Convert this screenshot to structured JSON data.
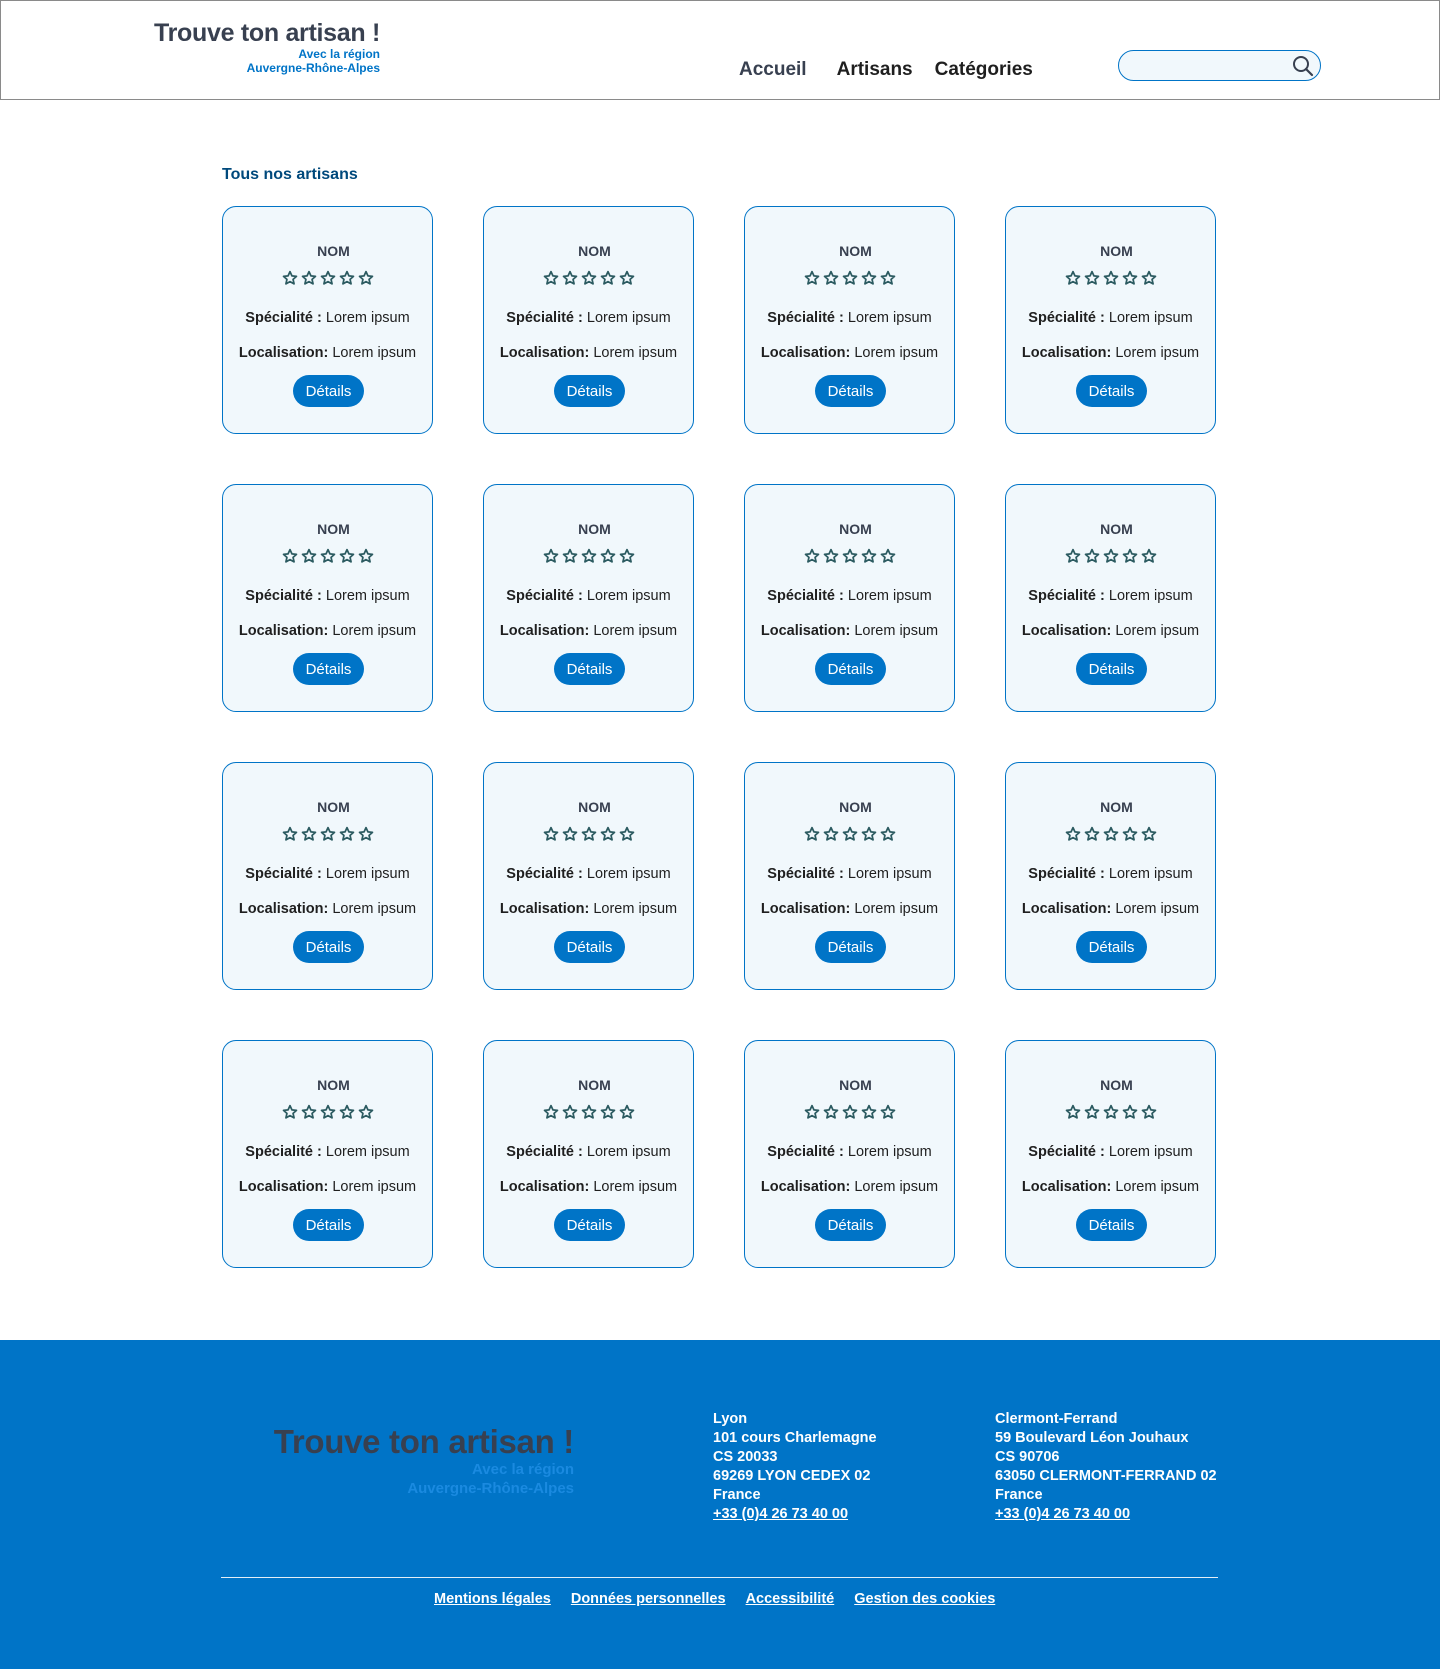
{
  "brand": {
    "title": "Trouve ton artisan !",
    "subtitle_1": "Avec la région",
    "subtitle_2": "Auvergne-Rhône-Alpes"
  },
  "nav": {
    "items": [
      {
        "label": "Accueil"
      },
      {
        "label": "Artisans"
      },
      {
        "label": "Catégories"
      }
    ]
  },
  "search": {
    "value": "",
    "icon": "search-icon"
  },
  "main": {
    "section_title": "Tous nos artisans",
    "cards": [
      {
        "name": "NOM",
        "rating": 0,
        "specialty_label": "Spécialité :",
        "specialty": "Lorem ipsum",
        "location_label": "Localisation:",
        "location": "Lorem ipsum",
        "button": "Détails"
      },
      {
        "name": "NOM",
        "rating": 0,
        "specialty_label": "Spécialité :",
        "specialty": "Lorem ipsum",
        "location_label": "Localisation:",
        "location": "Lorem ipsum",
        "button": "Détails"
      },
      {
        "name": "NOM",
        "rating": 0,
        "specialty_label": "Spécialité :",
        "specialty": "Lorem ipsum",
        "location_label": "Localisation:",
        "location": "Lorem ipsum",
        "button": "Détails"
      },
      {
        "name": "NOM",
        "rating": 0,
        "specialty_label": "Spécialité :",
        "specialty": "Lorem ipsum",
        "location_label": "Localisation:",
        "location": "Lorem ipsum",
        "button": "Détails"
      },
      {
        "name": "NOM",
        "rating": 0,
        "specialty_label": "Spécialité :",
        "specialty": "Lorem ipsum",
        "location_label": "Localisation:",
        "location": "Lorem ipsum",
        "button": "Détails"
      },
      {
        "name": "NOM",
        "rating": 0,
        "specialty_label": "Spécialité :",
        "specialty": "Lorem ipsum",
        "location_label": "Localisation:",
        "location": "Lorem ipsum",
        "button": "Détails"
      },
      {
        "name": "NOM",
        "rating": 0,
        "specialty_label": "Spécialité :",
        "specialty": "Lorem ipsum",
        "location_label": "Localisation:",
        "location": "Lorem ipsum",
        "button": "Détails"
      },
      {
        "name": "NOM",
        "rating": 0,
        "specialty_label": "Spécialité :",
        "specialty": "Lorem ipsum",
        "location_label": "Localisation:",
        "location": "Lorem ipsum",
        "button": "Détails"
      },
      {
        "name": "NOM",
        "rating": 0,
        "specialty_label": "Spécialité :",
        "specialty": "Lorem ipsum",
        "location_label": "Localisation:",
        "location": "Lorem ipsum",
        "button": "Détails"
      },
      {
        "name": "NOM",
        "rating": 0,
        "specialty_label": "Spécialité :",
        "specialty": "Lorem ipsum",
        "location_label": "Localisation:",
        "location": "Lorem ipsum",
        "button": "Détails"
      },
      {
        "name": "NOM",
        "rating": 0,
        "specialty_label": "Spécialité :",
        "specialty": "Lorem ipsum",
        "location_label": "Localisation:",
        "location": "Lorem ipsum",
        "button": "Détails"
      },
      {
        "name": "NOM",
        "rating": 0,
        "specialty_label": "Spécialité :",
        "specialty": "Lorem ipsum",
        "location_label": "Localisation:",
        "location": "Lorem ipsum",
        "button": "Détails"
      },
      {
        "name": "NOM",
        "rating": 0,
        "specialty_label": "Spécialité :",
        "specialty": "Lorem ipsum",
        "location_label": "Localisation:",
        "location": "Lorem ipsum",
        "button": "Détails"
      },
      {
        "name": "NOM",
        "rating": 0,
        "specialty_label": "Spécialité :",
        "specialty": "Lorem ipsum",
        "location_label": "Localisation:",
        "location": "Lorem ipsum",
        "button": "Détails"
      },
      {
        "name": "NOM",
        "rating": 0,
        "specialty_label": "Spécialité :",
        "specialty": "Lorem ipsum",
        "location_label": "Localisation:",
        "location": "Lorem ipsum",
        "button": "Détails"
      },
      {
        "name": "NOM",
        "rating": 0,
        "specialty_label": "Spécialité :",
        "specialty": "Lorem ipsum",
        "location_label": "Localisation:",
        "location": "Lorem ipsum",
        "button": "Détails"
      }
    ]
  },
  "footer": {
    "brand": {
      "title": "Trouve ton artisan !",
      "subtitle_1": "Avec la région",
      "subtitle_2": "Auvergne-Rhône-Alpes"
    },
    "addresses": [
      {
        "city": "Lyon",
        "street": "101 cours Charlemagne",
        "cs": "CS 20033",
        "postal": "69269 LYON CEDEX 02",
        "country": "France",
        "phone": "+33 (0)4 26 73 40 00"
      },
      {
        "city": "Clermont-Ferrand",
        "street": "59 Boulevard Léon Jouhaux",
        "cs": "CS 90706",
        "postal": "63050 CLERMONT-FERRAND 02",
        "country": "France",
        "phone": "+33 (0)4 26 73 40 00"
      }
    ],
    "legal_links": [
      {
        "label": "Mentions légales"
      },
      {
        "label": "Données personnelles"
      },
      {
        "label": "Accessibilité"
      },
      {
        "label": "Gestion des cookies"
      }
    ]
  },
  "colors": {
    "primary": "#0074c7",
    "card_bg": "#f1f8fc",
    "title_blue": "#00497c",
    "dark_text": "#384050",
    "star": "#2c5b61"
  }
}
